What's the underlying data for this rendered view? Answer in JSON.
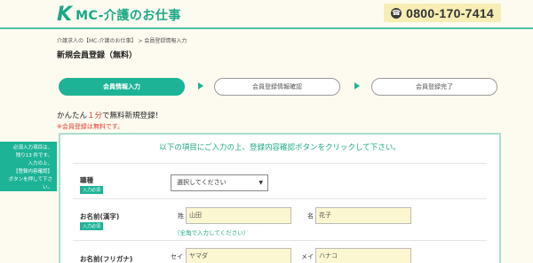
{
  "header": {
    "logo_mark": "K",
    "logo_text": "MC-介護のお仕事",
    "phone_icon": "☎",
    "phone": "0800-170-7414"
  },
  "breadcrumb": {
    "home": "介護求人の【MC-介護のお仕事】",
    "sep": ">",
    "current": "会員登録情報入力"
  },
  "page_title": "新規会員登録（無料）",
  "steps": {
    "step1": "会員情報入力",
    "step2": "会員登録情報確認",
    "step3": "会員登録完了"
  },
  "intro": {
    "pre": "かんたん",
    "highlight": "１分",
    "post": "で無料新規登録！",
    "note": "※会員登録は無料です。"
  },
  "side_note": {
    "line1": "必須入力項目は、",
    "line2": "残り13 件です。",
    "line3": "入力の上、",
    "line4": "【登録内容確認】",
    "line5": "ボタンを押して下さい。"
  },
  "form": {
    "lead": "以下の項目にご入力の上、登録内容確認ボタンをクリックして下さい。",
    "required_badge": "入力必須",
    "job": {
      "label": "職種",
      "selected": "選択してください"
    },
    "name_kanji": {
      "label": "お名前(漢字)",
      "sei_label": "姓",
      "sei_placeholder": "山田",
      "mei_label": "名",
      "mei_placeholder": "花子",
      "hint": "（全角で入力してください）"
    },
    "name_kana": {
      "label": "お名前(フリガナ)",
      "sei_label": "セイ",
      "sei_placeholder": "ヤマダ",
      "mei_label": "メイ",
      "mei_placeholder": "ハナコ"
    }
  }
}
